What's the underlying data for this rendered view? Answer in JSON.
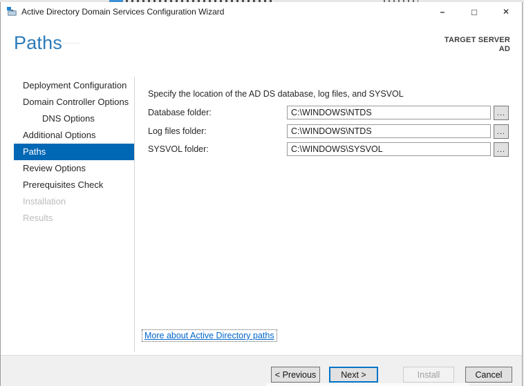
{
  "titlebar": {
    "title": "Active Directory Domain Services Configuration Wizard",
    "controls": {
      "minimize": "–",
      "maximize": "□",
      "close": "✕"
    }
  },
  "header": {
    "page_title": "Paths",
    "target_server_label": "TARGET SERVER",
    "target_server_name": "AD"
  },
  "sidebar": {
    "items": [
      {
        "label": "Deployment Configuration",
        "state": "normal"
      },
      {
        "label": "Domain Controller Options",
        "state": "normal"
      },
      {
        "label": "DNS Options",
        "state": "normal-indented"
      },
      {
        "label": "Additional Options",
        "state": "normal"
      },
      {
        "label": "Paths",
        "state": "selected"
      },
      {
        "label": "Review Options",
        "state": "normal"
      },
      {
        "label": "Prerequisites Check",
        "state": "normal"
      },
      {
        "label": "Installation",
        "state": "disabled"
      },
      {
        "label": "Results",
        "state": "disabled"
      }
    ]
  },
  "content": {
    "description": "Specify the location of the AD DS database, log files, and SYSVOL",
    "fields": [
      {
        "label": "Database folder:",
        "value": "C:\\WINDOWS\\NTDS"
      },
      {
        "label": "Log files folder:",
        "value": "C:\\WINDOWS\\NTDS"
      },
      {
        "label": "SYSVOL folder:",
        "value": "C:\\WINDOWS\\SYSVOL"
      }
    ],
    "browse_button_label": "...",
    "more_link": "More about Active Directory paths"
  },
  "footer": {
    "buttons": [
      {
        "label": "< Previous",
        "state": "normal"
      },
      {
        "label": "Next >",
        "state": "default-focused"
      },
      {
        "label": "Install",
        "state": "disabled"
      },
      {
        "label": "Cancel",
        "state": "normal"
      }
    ]
  },
  "colors": {
    "accent_blue": "#0067b5",
    "heading_blue": "#2b7bb9",
    "link_blue": "#0066cc",
    "focus_border_blue": "#0072c6"
  }
}
